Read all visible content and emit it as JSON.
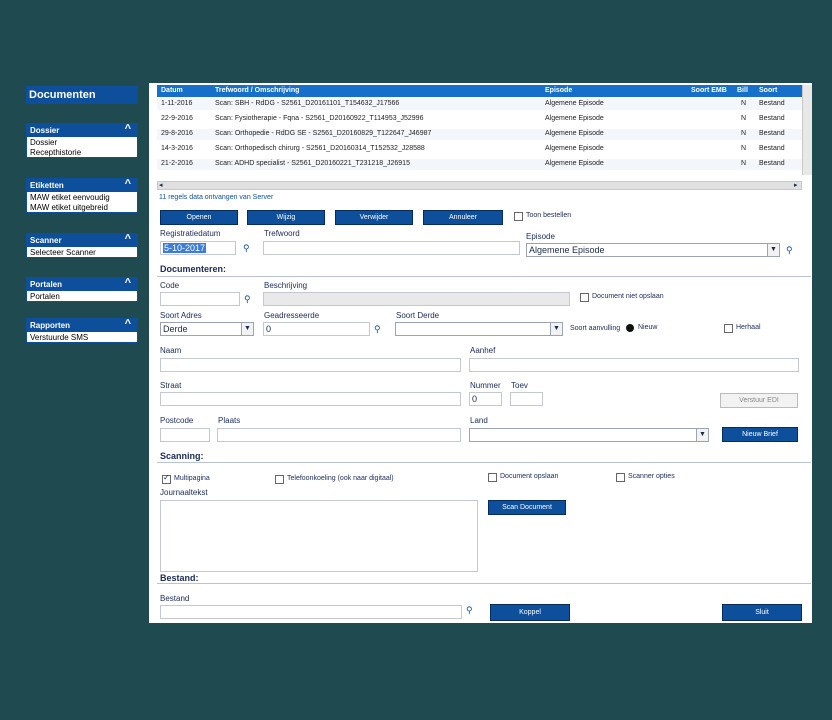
{
  "sidebar": {
    "title": "Documenten",
    "groups": [
      {
        "title": "Dossier",
        "items": [
          "Dossier",
          "Recepthistorie"
        ]
      },
      {
        "title": "Etiketten",
        "items": [
          "MAW etiket eenvoudig",
          "MAW etiket uitgebreid"
        ]
      },
      {
        "title": "Scanner",
        "items": [
          "Selecteer Scanner"
        ]
      },
      {
        "title": "Portalen",
        "items": [
          "Portalen"
        ]
      },
      {
        "title": "Rapporten",
        "items": [
          "Verstuurde SMS"
        ]
      }
    ]
  },
  "grid": {
    "columns": [
      "Datum",
      "Trefwoord / Omschrijving",
      "Episode",
      "Soort EMB",
      "Bill",
      "Soort"
    ],
    "rows": [
      {
        "datum": "1-11-2016",
        "omschrijving": "Scan: SBH - RdDG - S2561_D20161101_T154632_J17566",
        "episode": "Algemene Episode",
        "bill": "N",
        "soort": "Bestand"
      },
      {
        "datum": "22-9-2016",
        "omschrijving": "Scan: Fysiotherapie - Fqna - S2561_D20160922_T114953_J52996",
        "episode": "Algemene Episode",
        "bill": "N",
        "soort": "Bestand"
      },
      {
        "datum": "29-8-2016",
        "omschrijving": "Scan: Orthopedie - RdDG SE - S2561_D20160829_T122647_J46987",
        "episode": "Algemene Episode",
        "bill": "N",
        "soort": "Bestand"
      },
      {
        "datum": "14-3-2016",
        "omschrijving": "Scan: Orthopedisch chirurg - S2561_D20160314_T152532_J28588",
        "episode": "Algemene Episode",
        "bill": "N",
        "soort": "Bestand"
      },
      {
        "datum": "21-2-2016",
        "omschrijving": "Scan: ADHD specialist - S2561_D20160221_T231218_J26915",
        "episode": "Algemene Episode",
        "bill": "N",
        "soort": "Bestand"
      }
    ],
    "status": "11 regels data ontvangen van Server"
  },
  "buttons": {
    "openen": "Openen",
    "wijzig": "Wijzig",
    "verwijder": "Verwijder",
    "annuleer": "Annuleer",
    "toon_bestellen": "Toon bestellen",
    "verstuur_edi": "Verstuur EDI",
    "nieuw_brief": "Nieuw Brief",
    "scan_document": "Scan Document",
    "koppel": "Koppel",
    "sluit": "Sluit"
  },
  "form": {
    "registratiedatum_label": "Registratiedatum",
    "registratiedatum_value": "5-10-2017",
    "trefwoord_label": "Trefwoord",
    "episode_label": "Episode",
    "episode_value": "Algemene Episode",
    "documenteren": "Documenteren:",
    "code_label": "Code",
    "beschrijving_label": "Beschrijving",
    "document_niet_opslaan": "Document niet opslaan",
    "soort_adres_label": "Soort Adres",
    "soort_adres_value": "Derde",
    "geadresseerde_label": "Geadresseerde",
    "geadresseerde_value": "0",
    "soort_derde_label": "Soort Derde",
    "soort_aanvulling": "Soort aanvulling",
    "nieuw": "Nieuw",
    "herhaal": "Herhaal",
    "naam_label": "Naam",
    "aanhef_label": "Aanhef",
    "straat_label": "Straat",
    "nummer_label": "Nummer",
    "nummer_value": "0",
    "toev_label": "Toev",
    "postcode_label": "Postcode",
    "plaats_label": "Plaats",
    "land_label": "Land",
    "scanning": "Scanning:",
    "multipagina": "Multipagina",
    "telefoonkoeling": "Telefoonkoeling (ook naar digitaal)",
    "document_opslaan": "Document opslaan",
    "scanner_opties": "Scanner opties",
    "journaaltekst": "Journaaltekst",
    "bestand_section": "Bestand:",
    "bestand_label": "Bestand"
  },
  "colors": {
    "accent": "#0e4f9c",
    "header": "#1670c9",
    "background": "#1f4a4f"
  }
}
